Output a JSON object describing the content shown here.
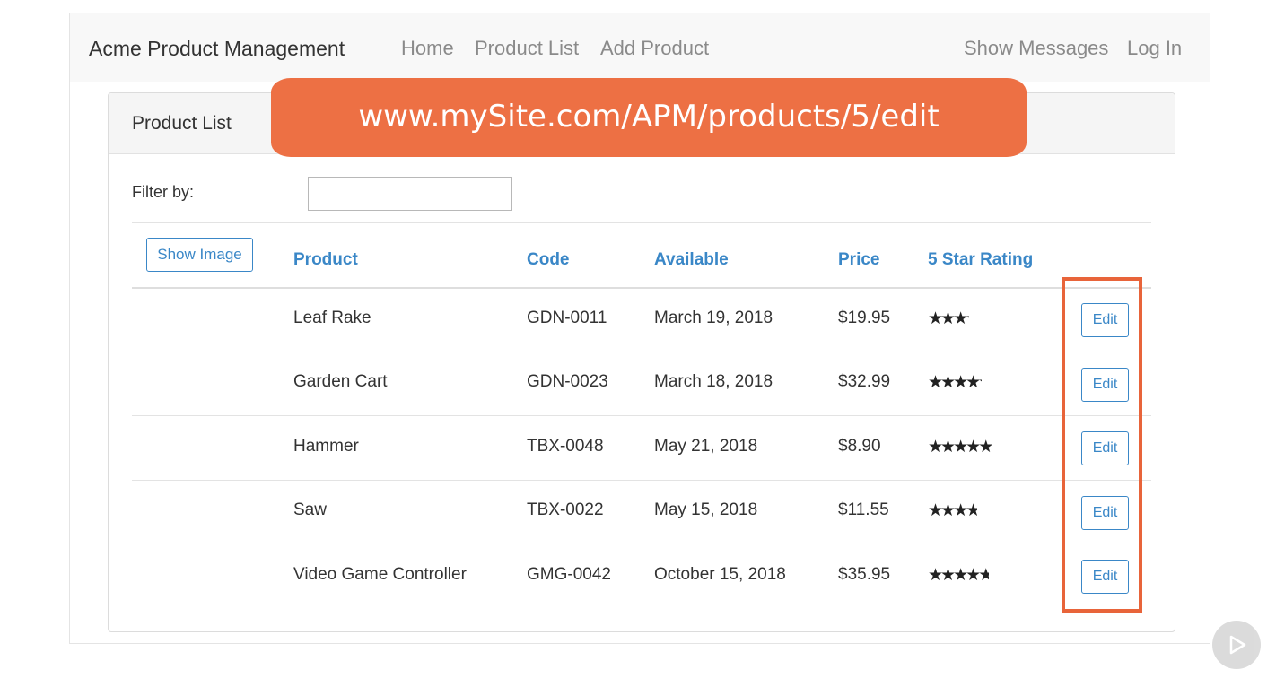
{
  "navbar": {
    "brand": "Acme Product Management",
    "links": [
      "Home",
      "Product List",
      "Add Product"
    ],
    "right_links": [
      "Show Messages",
      "Log In"
    ]
  },
  "card": {
    "title": "Product List",
    "filter_label": "Filter by:",
    "filter_value": "",
    "show_image_label": "Show Image",
    "columns": [
      "Product",
      "Code",
      "Available",
      "Price",
      "5 Star Rating"
    ],
    "rows": [
      {
        "product": "Leaf Rake",
        "code": "GDN-0011",
        "available": "March 19, 2018",
        "price": "$19.95",
        "rating": 3.2,
        "edit": "Edit"
      },
      {
        "product": "Garden Cart",
        "code": "GDN-0023",
        "available": "March 18, 2018",
        "price": "$32.99",
        "rating": 4.2,
        "edit": "Edit"
      },
      {
        "product": "Hammer",
        "code": "TBX-0048",
        "available": "May 21, 2018",
        "price": "$8.90",
        "rating": 4.8,
        "edit": "Edit"
      },
      {
        "product": "Saw",
        "code": "TBX-0022",
        "available": "May 15, 2018",
        "price": "$11.55",
        "rating": 3.7,
        "edit": "Edit"
      },
      {
        "product": "Video Game Controller",
        "code": "GMG-0042",
        "available": "October 15, 2018",
        "price": "$35.95",
        "rating": 4.6,
        "edit": "Edit"
      }
    ]
  },
  "overlay": {
    "url_text": "www.mySite.com/APM/products/5/edit"
  },
  "colors": {
    "accent_blue": "#3a87c7",
    "banner_orange": "#ed7044",
    "highlight_orange": "#e8643a"
  },
  "icons": {
    "star": "star-icon",
    "play": "play-icon"
  }
}
